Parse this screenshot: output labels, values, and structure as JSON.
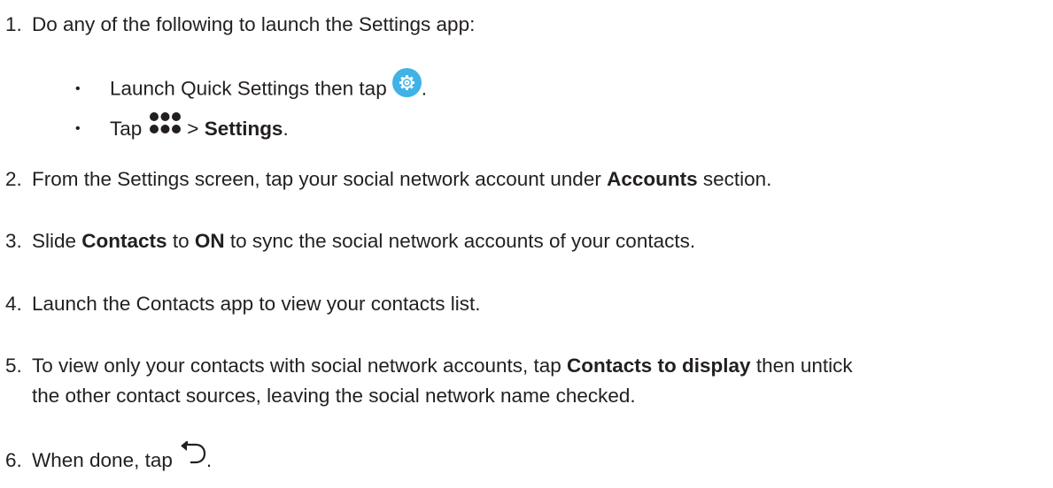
{
  "steps": [
    {
      "number": "1.",
      "text": "Do any of the following to launch the Settings app:"
    },
    {
      "number": "2.",
      "pre": "From the Settings screen, tap your social network account under ",
      "bold": "Accounts",
      "post": " section."
    },
    {
      "number": "3.",
      "pre": "Slide ",
      "bold1": "Contacts",
      "mid": " to ",
      "bold2": "ON",
      "post": " to sync the social network accounts of your contacts."
    },
    {
      "number": "4.",
      "text": "Launch the Contacts app to view your contacts list."
    },
    {
      "number": "5.",
      "pre": "To view only your contacts with social network accounts, tap ",
      "bold": "Contacts to display",
      "post": " then untick",
      "line2": "the other contact sources, leaving the social network name checked."
    },
    {
      "number": "6.",
      "pre": "When done, tap",
      "post": "."
    }
  ],
  "substeps": [
    {
      "bullet": "•",
      "pre": "Launch Quick Settings then tap",
      "post": ".",
      "icon": "settings-gear-icon"
    },
    {
      "bullet": "•",
      "pre": "Tap",
      "mid": "> ",
      "bold": "Settings",
      "post": ".",
      "icon": "all-apps-dots-icon"
    }
  ],
  "colors": {
    "text": "#231f20",
    "gear_bg": "#3fb2e6",
    "icon_dark": "#231f20"
  }
}
